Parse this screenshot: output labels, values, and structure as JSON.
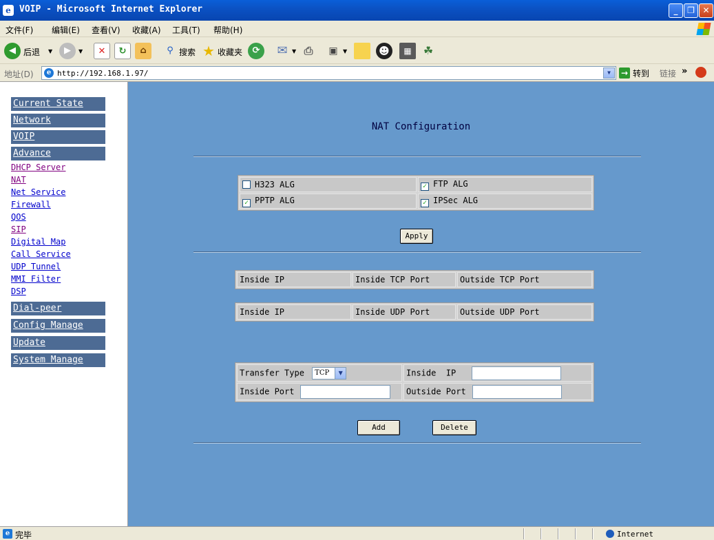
{
  "window": {
    "title": "VOIP - Microsoft Internet Explorer"
  },
  "menu": [
    "文件(F)",
    "编辑(E)",
    "查看(V)",
    "收藏(A)",
    "工具(T)",
    "帮助(H)"
  ],
  "toolbar": {
    "back": "后退",
    "search": "搜索",
    "favorites": "收藏夹"
  },
  "address": {
    "label": "地址(D)",
    "url": "http://192.168.1.97/",
    "go": "转到",
    "links": "链接",
    "links_arrow": "»"
  },
  "sidebar": {
    "headers": [
      "Current State",
      "Network",
      "VOIP",
      "Advance"
    ],
    "links": [
      "DHCP Server",
      "NAT",
      "Net Service",
      "Firewall",
      "QOS",
      "SIP",
      "Digital Map",
      "Call Service",
      "UDP Tunnel",
      "MMI Filter",
      "DSP"
    ],
    "footer_headers": [
      "Dial-peer",
      "Config Manage",
      "Update",
      "System Manage"
    ]
  },
  "main": {
    "title": "NAT Configuration",
    "alg": [
      {
        "label": "H323 ALG",
        "checked": false
      },
      {
        "label": "FTP ALG",
        "checked": true
      },
      {
        "label": "PPTP ALG",
        "checked": true
      },
      {
        "label": "IPSec ALG",
        "checked": true
      }
    ],
    "apply_label": "Apply",
    "tcp_headers": [
      "Inside IP",
      "Inside TCP Port",
      "Outside TCP Port"
    ],
    "udp_headers": [
      "Inside IP",
      "Inside UDP Port",
      "Outside UDP Port"
    ],
    "form": {
      "transfer_type_label": "Transfer Type",
      "transfer_type_value": "TCP",
      "inside_ip_label": "Inside  IP",
      "inside_port_label": "Inside Port",
      "outside_port_label": "Outside Port"
    },
    "add_label": "Add",
    "delete_label": "Delete"
  },
  "status": {
    "text": "完毕",
    "zone": "Internet"
  }
}
